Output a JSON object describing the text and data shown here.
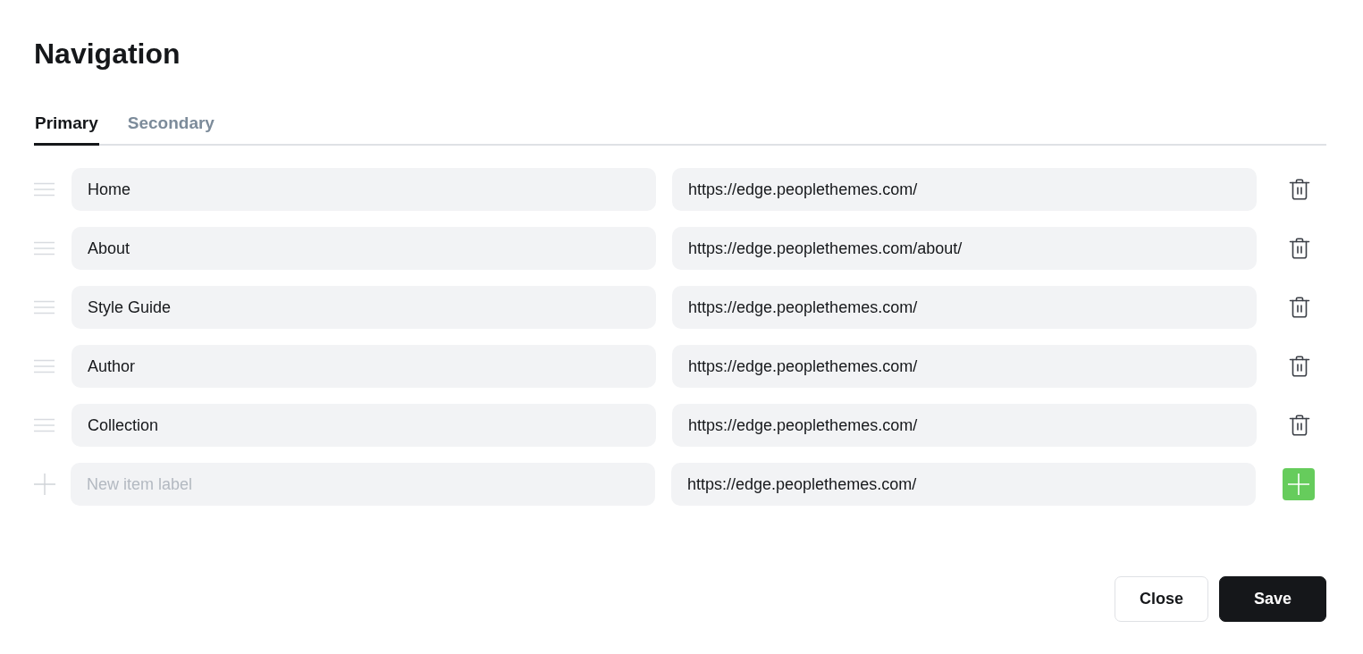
{
  "title": "Navigation",
  "tabs": [
    {
      "label": "Primary",
      "selected": true
    },
    {
      "label": "Secondary",
      "selected": false
    }
  ],
  "items": [
    {
      "label": "Home",
      "url": "https://edge.peoplethemes.com/"
    },
    {
      "label": "About",
      "url": "https://edge.peoplethemes.com/about/"
    },
    {
      "label": "Style Guide",
      "url": "https://edge.peoplethemes.com/"
    },
    {
      "label": "Author",
      "url": "https://edge.peoplethemes.com/"
    },
    {
      "label": "Collection",
      "url": "https://edge.peoplethemes.com/"
    }
  ],
  "new_item": {
    "placeholder": "New item label",
    "url": "https://edge.peoplethemes.com/"
  },
  "buttons": [
    {
      "label": "Close",
      "kind": "secondary"
    },
    {
      "label": "Save",
      "kind": "primary"
    }
  ]
}
